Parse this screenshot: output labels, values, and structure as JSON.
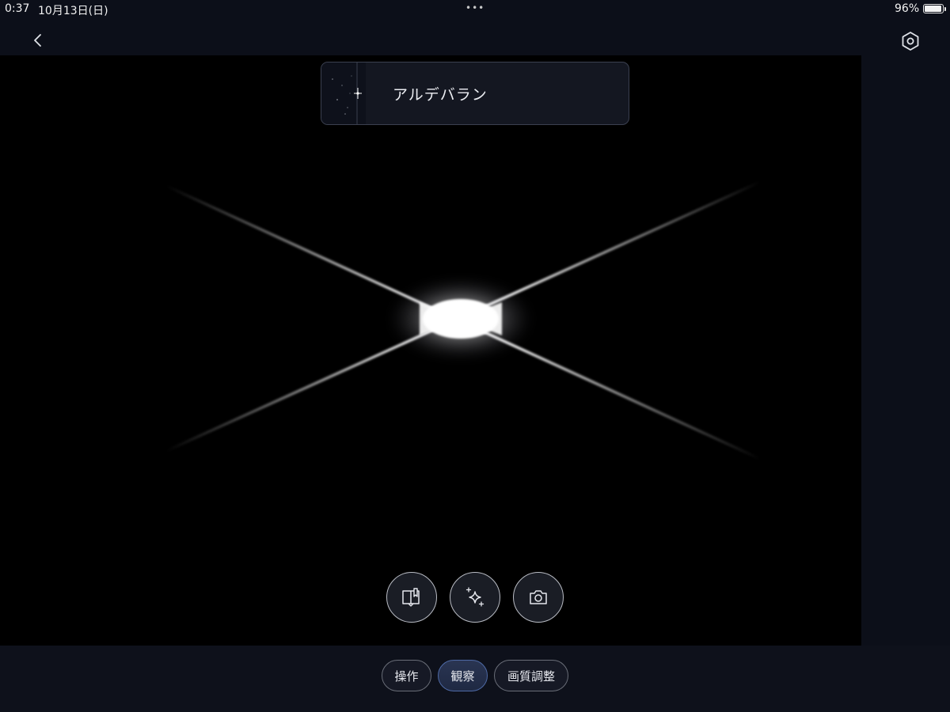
{
  "status_bar": {
    "time": "0:37",
    "date": "10月13日(日)",
    "dots": "•••",
    "battery_percent": "96%"
  },
  "target_card": {
    "name": "アルデバラン"
  },
  "icons": {
    "back": "chevron-left-icon",
    "settings": "hexagon-gear-icon",
    "guide": "book-marker-icon",
    "enhance": "sparkles-icon",
    "capture": "camera-icon"
  },
  "tabs": [
    {
      "label": "操作",
      "active": false
    },
    {
      "label": "観察",
      "active": true
    },
    {
      "label": "画質調整",
      "active": false
    }
  ],
  "colors": {
    "accent_tab": "#2a3552",
    "accent_border": "#4e6aa6",
    "background": "#0c0f19"
  }
}
